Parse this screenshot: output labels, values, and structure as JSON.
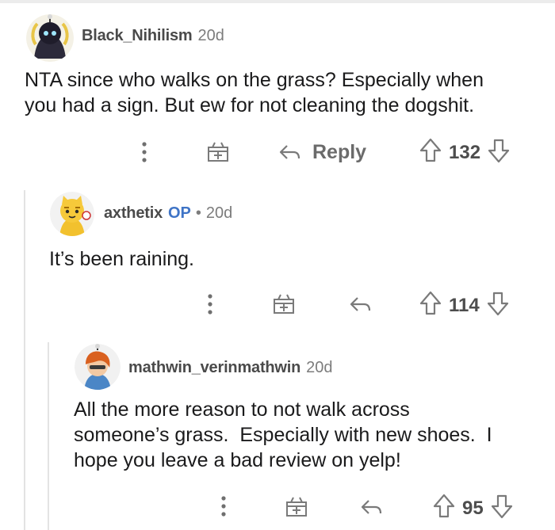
{
  "comments": [
    {
      "username": "Black_Nihilism",
      "age": "20d",
      "body_lines": [
        "NTA since who walks on the grass? Especially when",
        "you had a sign. But ew for not cleaning the dogshit."
      ],
      "reply_label": "Reply",
      "score": "132",
      "avatar_icon": "dark-character-avatar-icon"
    },
    {
      "username": "axthetix",
      "op_badge": "OP",
      "separator": "•",
      "age": "20d",
      "body_lines": [
        "It’s been raining."
      ],
      "score": "114",
      "avatar_icon": "yellow-cat-avatar-icon"
    },
    {
      "username": "mathwin_verinmathwin",
      "age": "20d",
      "body_lines": [
        "All the more reason to not walk across",
        "someone’s grass.  Especially with new shoes.  I",
        "hope you leave a bad review on yelp!"
      ],
      "score": "95",
      "avatar_icon": "orange-hair-avatar-icon"
    }
  ],
  "colors": {
    "username": "#4a4a4a",
    "op_badge": "#3f74c6",
    "meta": "#7c7c7c",
    "icon": "#7a7a7a",
    "thread_line": "#e3e3e3"
  }
}
